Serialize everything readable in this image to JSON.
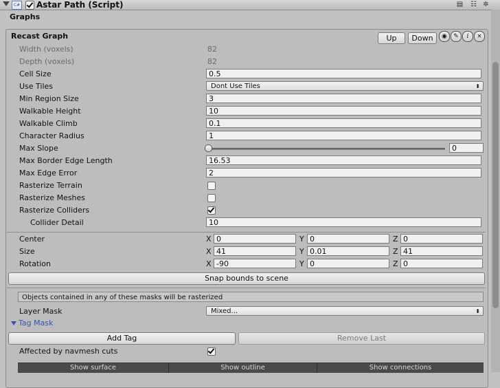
{
  "component": {
    "title": "Astar Path (Script)",
    "script_icon_text": "C#"
  },
  "header_icons": [
    "book-icon",
    "settings-sliders-icon",
    "gear-icon"
  ],
  "section_title": "Graphs",
  "graph": {
    "title": "Recast Graph",
    "up_label": "Up",
    "down_label": "Down",
    "info_label": "i",
    "close_label": "×"
  },
  "fields": {
    "width_label": "Width (voxels)",
    "width_value": "82",
    "depth_label": "Depth (voxels)",
    "depth_value": "82",
    "cell_size_label": "Cell Size",
    "cell_size_value": "0.5",
    "use_tiles_label": "Use Tiles",
    "use_tiles_value": "Dont Use Tiles",
    "min_region_label": "Min Region Size",
    "min_region_value": "3",
    "walk_height_label": "Walkable Height",
    "walk_height_value": "10",
    "walk_climb_label": "Walkable Climb",
    "walk_climb_value": "0.1",
    "char_radius_label": "Character Radius",
    "char_radius_value": "1",
    "max_slope_label": "Max Slope",
    "max_slope_value": "0",
    "max_border_label": "Max Border Edge Length",
    "max_border_value": "16.53",
    "max_edge_err_label": "Max Edge Error",
    "max_edge_err_value": "2",
    "rast_terrain_label": "Rasterize Terrain",
    "rast_terrain_checked": false,
    "rast_meshes_label": "Rasterize Meshes",
    "rast_meshes_checked": false,
    "rast_colliders_label": "Rasterize Colliders",
    "rast_colliders_checked": true,
    "collider_detail_label": "Collider Detail",
    "collider_detail_value": "10"
  },
  "bounds": {
    "center_label": "Center",
    "center": {
      "x": "0",
      "y": "0",
      "z": "0"
    },
    "size_label": "Size",
    "size": {
      "x": "41",
      "y": "0.01",
      "z": "41"
    },
    "rotation_label": "Rotation",
    "rotation": {
      "x": "-90",
      "y": "0",
      "z": "0"
    },
    "axis_x": "X",
    "axis_y": "Y",
    "axis_z": "Z",
    "snap_label": "Snap bounds to scene"
  },
  "masks": {
    "help_text": "Objects contained in any of these masks will be rasterized",
    "layer_mask_label": "Layer Mask",
    "layer_mask_value": "Mixed...",
    "tag_mask_label": "Tag Mask",
    "add_tag_label": "Add Tag",
    "remove_last_label": "Remove Last",
    "navmesh_cuts_label": "Affected by navmesh cuts",
    "navmesh_cuts_checked": true
  },
  "bottom_tabs": [
    "Show surface",
    "Show outline",
    "Show connections"
  ]
}
